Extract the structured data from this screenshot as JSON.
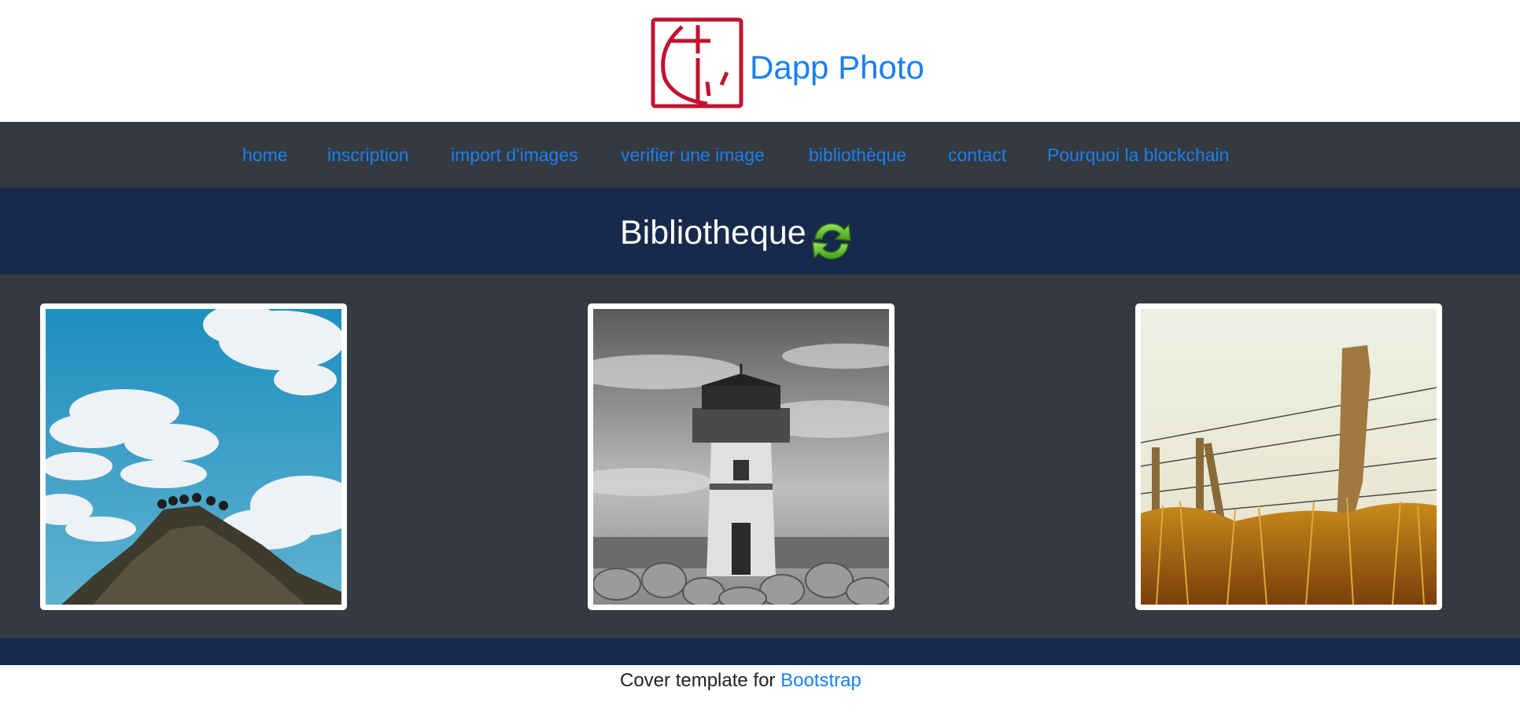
{
  "header": {
    "brand": "Dapp Photo",
    "logo_icon": "camera-signature-logo",
    "logo_color": "#c4122f"
  },
  "nav": {
    "items": [
      {
        "label": "home"
      },
      {
        "label": "inscription"
      },
      {
        "label": "import d'images"
      },
      {
        "label": "verifier une image"
      },
      {
        "label": "bibliothèque"
      },
      {
        "label": "contact"
      },
      {
        "label": "Pourquoi la blockchain"
      }
    ],
    "link_color": "#1a7ff0",
    "background": "#343a40"
  },
  "main": {
    "title": "Bibliotheque",
    "refresh_icon": "refresh-icon",
    "band_color": "#172a4c"
  },
  "gallery": {
    "images": [
      {
        "icon": "mountain-sky-photo"
      },
      {
        "icon": "lighthouse-photo"
      },
      {
        "icon": "fence-post-photo"
      }
    ]
  },
  "footer": {
    "text": "Cover template for",
    "link": "Bootstrap"
  }
}
